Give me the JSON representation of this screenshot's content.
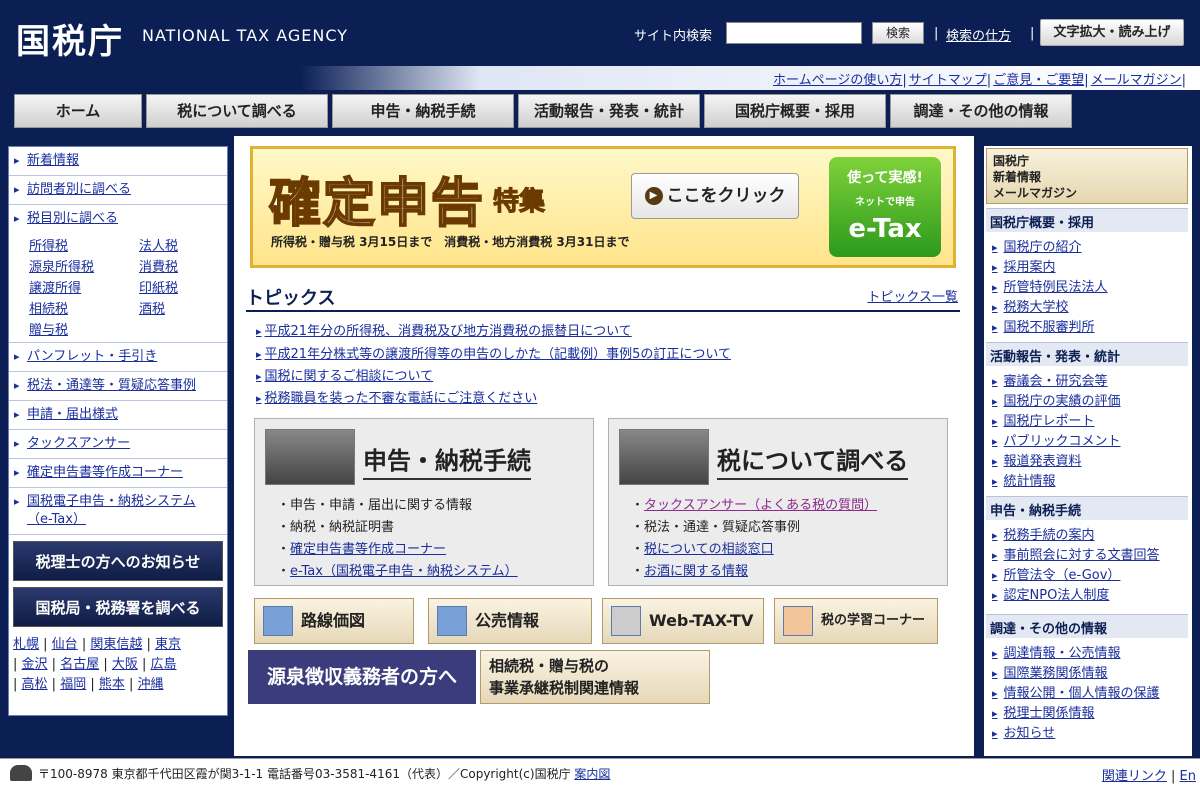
{
  "header": {
    "logo": "国税庁",
    "logo_en": "NATIONAL TAX AGENCY",
    "search_label": "サイト内検索",
    "search_value": "",
    "search_button": "検索",
    "search_howto": "検索の仕方",
    "zoom_button": "文字拡大・読み上げ"
  },
  "util_links": [
    "ホームページの使い方",
    "サイトマップ",
    "ご意見・ご要望",
    "メールマガジン"
  ],
  "nav": [
    {
      "label": "ホーム"
    },
    {
      "label": "税について調べる"
    },
    {
      "label": "申告・納税手続"
    },
    {
      "label": "活動報告・発表・統計"
    },
    {
      "label": "国税庁概要・採用"
    },
    {
      "label": "調達・その他の情報"
    }
  ],
  "left": {
    "items_top": [
      "新着情報",
      "訪問者別に調べる",
      "税目別に調べる"
    ],
    "taxes": [
      "所得税",
      "法人税",
      "源泉所得税",
      "消費税",
      "譲渡所得",
      "印紙税",
      "相続税",
      "酒税",
      "贈与税"
    ],
    "items_bottom": [
      "パンフレット・手引き",
      "税法・通達等・質疑応答事例",
      "申請・届出様式",
      "タックスアンサー",
      "確定申告書等作成コーナー",
      "国税電子申告・納税システム（e-Tax）"
    ],
    "tax_accountant_btn": "税理士の方へのお知らせ",
    "bureau_btn": "国税局・税務署を調べる",
    "cities": [
      "札幌",
      "仙台",
      "関東信越",
      "東京",
      "金沢",
      "名古屋",
      "大阪",
      "広島",
      "高松",
      "福岡",
      "熊本",
      "沖縄"
    ]
  },
  "banner": {
    "title": "確定申告",
    "sub": "特集",
    "line1": "所得税・贈与税 3月15日まで　消費税・地方消費税 3月31日まで",
    "click": "ここをクリック",
    "etax_top": "使って実感!",
    "etax_mid": "ネットで申告",
    "etax_bottom": "e-Tax"
  },
  "topics": {
    "heading": "トピックス",
    "all_link": "トピックス一覧",
    "items": [
      "平成21年分の所得税、消費税及び地方消費税の振替日について",
      "平成21年分株式等の譲渡所得等の申告のしかた（記載例）事例5の訂正について",
      "国税に関するご相談について",
      "税務職員を装った不審な電話にご注意ください"
    ]
  },
  "cards": [
    {
      "title": "申告・納税手続",
      "items": [
        "申告・申請・届出に関する情報",
        "納税・納税証明書",
        "確定申告書等作成コーナー",
        "e-Tax（国税電子申告・納税システム）"
      ],
      "links": [
        false,
        false,
        true,
        true
      ]
    },
    {
      "title": "税について調べる",
      "items": [
        "タックスアンサー（よくある税の質問）",
        "税法・通達・質疑応答事例",
        "税についての相談窓口",
        "お酒に関する情報"
      ],
      "links": [
        true,
        false,
        true,
        true
      ]
    }
  ],
  "quick": [
    "路線価図",
    "公売情報",
    "Web-TAX-TV",
    "税の学習コーナー"
  ],
  "gensen": "源泉徴収義務者の方へ",
  "souzoku": {
    "line1": "相続税・贈与税の",
    "line2": "事業承継税制関連情報"
  },
  "right": {
    "magazine": {
      "line1": "国税庁",
      "line2": "新着情報",
      "line3": "メールマガジン"
    },
    "sections": [
      {
        "title": "国税庁概要・採用",
        "links": [
          "国税庁の紹介",
          "採用案内",
          "所管特例民法法人",
          "税務大学校",
          "国税不服審判所"
        ]
      },
      {
        "title": "活動報告・発表・統計",
        "links": [
          "審議会・研究会等",
          "国税庁の実績の評価",
          "国税庁レポート",
          "パブリックコメント",
          "報道発表資料",
          "統計情報"
        ]
      },
      {
        "title": "申告・納税手続",
        "links": [
          "税務手続の案内",
          "事前照会に対する文書回答",
          "所管法令（e-Gov）",
          "認定NPO法人制度"
        ]
      },
      {
        "title": "調達・その他の情報",
        "links": [
          "調達情報・公売情報",
          "国際業務関係情報",
          "情報公開・個人情報の保護",
          "税理士関係情報",
          "お知らせ"
        ]
      }
    ]
  },
  "footer": {
    "address": "〒100-8978 東京都千代田区霞が関3-1-1 電話番号03-3581-4161（代表）／Copyright(c)国税庁",
    "guide": "案内図",
    "related": "関連リンク",
    "en": "En"
  }
}
